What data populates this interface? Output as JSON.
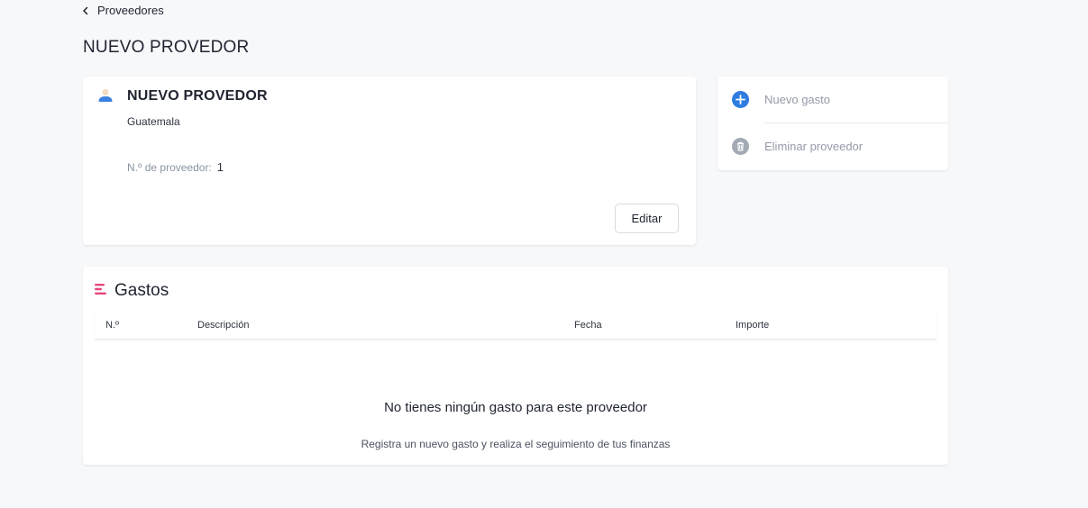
{
  "breadcrumb": {
    "label": "Proveedores"
  },
  "page": {
    "title": "NUEVO PROVEDOR"
  },
  "supplier": {
    "name": "NUEVO PROVEDOR",
    "country": "Guatemala",
    "number_label": "N.º de proveedor:",
    "number_value": "1",
    "edit_label": "Editar"
  },
  "actions": {
    "new_expense": "Nuevo gasto",
    "delete_supplier": "Eliminar proveedor"
  },
  "expenses": {
    "title": "Gastos",
    "columns": [
      "N.º",
      "Descripción",
      "Fecha",
      "Importe"
    ],
    "empty_title": "No tienes ningún gasto para este proveedor",
    "empty_subtitle": "Registra un nuevo gasto y realiza el seguimiento de tus finanzas"
  },
  "icons": {
    "back": "chevron-left-icon",
    "avatar": "user-icon",
    "new_expense": "plus-circle-icon",
    "delete": "trash-icon",
    "expenses": "list-icon"
  },
  "colors": {
    "accent_blue": "#2f7de1",
    "brand_pink": "#e8457a",
    "muted_gray": "#939aa7"
  }
}
